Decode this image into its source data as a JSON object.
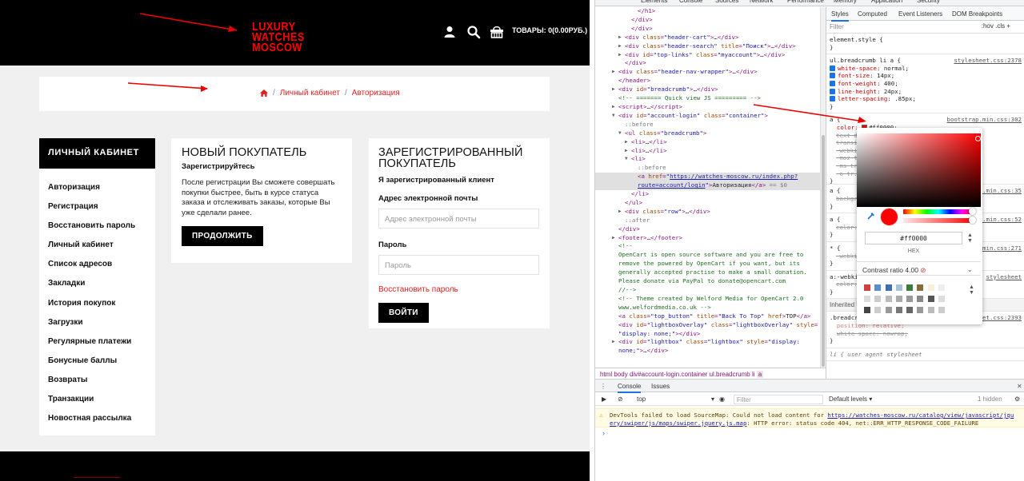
{
  "site": {
    "logo_lines": [
      "LUXURY",
      "WATCHES",
      "MOSCOW"
    ],
    "cart_text": "ТОВАРЫ: 0(0.00РУБ.)",
    "breadcrumb": [
      "Личный кабинет",
      "Авторизация"
    ],
    "breadcrumb_sep": "/",
    "account_menu": {
      "title": "ЛИЧНЫЙ КАБИНЕТ",
      "items": [
        "Авторизация",
        "Регистрация",
        "Восстановить пароль",
        "Личный кабинет",
        "Список адресов",
        "Закладки",
        "История покупок",
        "Загрузки",
        "Регулярные платежи",
        "Бонусные баллы",
        "Возвраты",
        "Транзакции",
        "Новостная рассылка"
      ]
    },
    "new_customer": {
      "title": "НОВЫЙ ПОКУПАТЕЛЬ",
      "subtitle": "Зарегистрируйтесь",
      "text": "После регистрации Вы сможете совершать покупки быстрее, быть в курсе статуса заказа и отслеживать заказы, которые Вы уже сделали ранее.",
      "button": "ПРОДОЛЖИТЬ"
    },
    "registered": {
      "title": "ЗАРЕГИСТРИРОВАННЫЙ ПОКУПАТЕЛЬ",
      "subtitle": "Я зарегистрированный клиент",
      "email_label": "Адрес электронной почты",
      "email_placeholder": "Адрес электронной почты",
      "password_label": "Пароль",
      "password_placeholder": "Пароль",
      "forgot_link": "Восстановить пароль",
      "button": "ВОЙТИ"
    },
    "accent_color": "#ff0000"
  },
  "devtools": {
    "top_tabs": [
      "Elements",
      "Console",
      "Sources",
      "Network",
      "Performance",
      "Memory",
      "Application",
      "Security"
    ],
    "dom_lines": [
      {
        "ind": 3,
        "html": "<span class='tg'>&lt;/h1&gt;</span>"
      },
      {
        "ind": 2,
        "html": "<span class='tg'>&lt;/div&gt;</span>"
      },
      {
        "ind": 2,
        "html": "<span class='tg'>&lt;/div&gt;</span>"
      },
      {
        "ind": 1,
        "tri": "▶",
        "html": "<span class='tg'>&lt;div</span> <span class='an'>class</span>=<span class='av'>\"header-cart\"</span><span class='tg'>&gt;</span><span class='tx'>…</span><span class='tg'>&lt;/div&gt;</span>"
      },
      {
        "ind": 1,
        "tri": "▶",
        "html": "<span class='tg'>&lt;div</span> <span class='an'>class</span>=<span class='av'>\"header-search\"</span> <span class='an'>title</span>=<span class='av'>\"Поиск\"</span><span class='tg'>&gt;</span><span class='tx'>…</span><span class='tg'>&lt;/div&gt;</span>"
      },
      {
        "ind": 1,
        "tri": "▶",
        "html": "<span class='tg'>&lt;div</span> <span class='an'>id</span>=<span class='av'>\"top-links\"</span> <span class='an'>class</span>=<span class='av'>\"myaccount\"</span><span class='tg'>&gt;</span><span class='tx'>…</span><span class='tg'>&lt;/div&gt;</span>"
      },
      {
        "ind": 1,
        "html": "<span class='tg'>&lt;/div&gt;</span>"
      },
      {
        "ind": 0,
        "tri": "▶",
        "html": "<span class='tg'>&lt;div</span> <span class='an'>class</span>=<span class='av'>\"header-nav-wrapper\"</span><span class='tg'>&gt;</span><span class='tx'>…</span><span class='tg'>&lt;/div&gt;</span>"
      },
      {
        "ind": 0,
        "html": "<span class='tg'>&lt;/header&gt;</span>"
      },
      {
        "ind": 0,
        "tri": "▶",
        "html": "<span class='tg'>&lt;div</span> <span class='an'>id</span>=<span class='av'>\"breadcrumb\"</span><span class='tg'>&gt;</span><span class='tx'>…</span><span class='tg'>&lt;/div&gt;</span>"
      },
      {
        "ind": 0,
        "html": "<span class='cm'>&lt;!-- ======= Quick view JS ========= --&gt;</span>"
      },
      {
        "ind": 0,
        "tri": "▶",
        "html": "<span class='tg'>&lt;script&gt;</span><span class='tx'>…</span><span class='tg'>&lt;/script&gt;</span>"
      },
      {
        "ind": 0,
        "tri": "▼",
        "html": "<span class='tg'>&lt;div</span> <span class='an'>id</span>=<span class='av'>\"account-login\"</span> <span class='an'>class</span>=<span class='av'>\"container\"</span><span class='tg'>&gt;</span>"
      },
      {
        "ind": 1,
        "html": "<span class='pe'>::before</span>"
      },
      {
        "ind": 1,
        "tri": "▼",
        "html": "<span class='tg'>&lt;ul</span> <span class='an'>class</span>=<span class='av'>\"breadcrumb\"</span><span class='tg'>&gt;</span>"
      },
      {
        "ind": 2,
        "tri": "▶",
        "html": "<span class='tg'>&lt;li&gt;</span><span class='tx'>…</span><span class='tg'>&lt;/li&gt;</span>"
      },
      {
        "ind": 2,
        "tri": "▶",
        "html": "<span class='tg'>&lt;li&gt;</span><span class='tx'>…</span><span class='tg'>&lt;/li&gt;</span>"
      },
      {
        "ind": 2,
        "tri": "▼",
        "html": "<span class='tg'>&lt;li&gt;</span>"
      },
      {
        "ind": 3,
        "html": "<span class='pe'>::before</span>"
      },
      {
        "ind": 3,
        "sel": true,
        "html": "<span class='tg'>&lt;a</span> <span class='an'>href</span>=<span class='av'>\"<span class='lk'>https://watches-moscow.ru/index.php?</span></span>"
      },
      {
        "ind": 3,
        "sel": true,
        "html": "<span class='av'><span class='lk'>route=account/login</span>\"</span><span class='tg'>&gt;</span><span class='tx'>Авторизация</span><span class='tg'>&lt;/a&gt;</span> <span class='pe'>== $0</span>"
      },
      {
        "ind": 2,
        "html": "<span class='tg'>&lt;/li&gt;</span>"
      },
      {
        "ind": 1,
        "html": "<span class='tg'>&lt;/ul&gt;</span>"
      },
      {
        "ind": 1,
        "tri": "▶",
        "html": "<span class='tg'>&lt;div</span> <span class='an'>class</span>=<span class='av'>\"row\"</span><span class='tg'>&gt;</span><span class='tx'>…</span><span class='tg'>&lt;/div&gt;</span>"
      },
      {
        "ind": 1,
        "html": "<span class='pe'>::after</span>"
      },
      {
        "ind": 0,
        "html": "<span class='tg'>&lt;/div&gt;</span>"
      },
      {
        "ind": 0,
        "tri": "▶",
        "html": "<span class='tg'>&lt;footer&gt;</span><span class='tx'>…</span><span class='tg'>&lt;/footer&gt;</span>"
      },
      {
        "ind": 0,
        "html": "<span class='cm'>&lt;!--</span>"
      },
      {
        "ind": 0,
        "html": "<span class='cm'>OpenCart is open source software and you are free to</span>"
      },
      {
        "ind": 0,
        "html": "<span class='cm'>remove the powered by OpenCart if you want, but its</span>"
      },
      {
        "ind": 0,
        "html": "<span class='cm'>generally accepted practise to make a small donation.</span>"
      },
      {
        "ind": 0,
        "html": "<span class='cm'>Please donate via PayPal to donate@opencart.com</span>"
      },
      {
        "ind": 0,
        "html": "<span class='cm'>//--&gt;</span>"
      },
      {
        "ind": 0,
        "html": "<span class='cm'>&lt;!-- Theme created by Welford Media for OpenCart 2.0</span>"
      },
      {
        "ind": 0,
        "html": "<span class='cm'>www.welfordmedia.co.uk --&gt;</span>"
      },
      {
        "ind": 0,
        "html": "<span class='tg'>&lt;a</span> <span class='an'>class</span>=<span class='av'>\"top_button\"</span> <span class='an'>title</span>=<span class='av'>\"Back To Top\"</span> <span class='an'>href</span><span class='tg'>&gt;</span><span class='tx'>TOP</span><span class='tg'>&lt;/a&gt;</span>"
      },
      {
        "ind": 0,
        "html": "<span class='tg'>&lt;div</span> <span class='an'>id</span>=<span class='av'>\"lightboxOverlay\"</span> <span class='an'>class</span>=<span class='av'>\"lightboxOverlay\"</span> <span class='an'>style</span>="
      },
      {
        "ind": 0,
        "html": "<span class='av'>\"display: none;\"</span><span class='tg'>&gt;&lt;/div&gt;</span>"
      },
      {
        "ind": 0,
        "tri": "▶",
        "html": "<span class='tg'>&lt;div</span> <span class='an'>id</span>=<span class='av'>\"lightbox\"</span> <span class='an'>class</span>=<span class='av'>\"lightbox\"</span> <span class='an'>style</span>=<span class='av'>\"display:</span>"
      },
      {
        "ind": 0,
        "html": "<span class='av'>none;\"</span><span class='tg'>&gt;</span><span class='tx'>…</span><span class='tg'>&lt;/div&gt;</span>"
      }
    ],
    "dom_crumbs": [
      "html",
      "body",
      "div#account-login.container",
      "ul.breadcrumb",
      "li",
      "a"
    ],
    "styles_tabs": [
      "Styles",
      "Computed",
      "Event Listeners",
      "DOM Breakpoints"
    ],
    "filter_placeholder": "Filter",
    "hov_cls": ":hov  .cls  +",
    "element_style": "element.style {",
    "rule1": {
      "selector": "ul.breadcrumb li a {",
      "source": "stylesheet.css:2378",
      "props": [
        "white-space: normal;",
        "font-size: 14px;",
        "font-weight: 400;",
        "line-height: 24px;",
        "letter-spacing: .85px;"
      ]
    },
    "rule2_source": "bootstrap.min.css:302",
    "rule2_color_prop": "color:",
    "rule2_color_val": "#ff0000;",
    "rule2_struck": [
      "text-d...",
      "transi...",
      "-webki...",
      "-moz-t...",
      "-ms-tr...",
      "-o-tr..."
    ],
    "partial_rules": [
      {
        "sel": "a {",
        "src": "...min.css:35",
        "line": "backgr..."
      },
      {
        "sel": "a {",
        "src": "...min.css:52",
        "line": "color:"
      },
      {
        "sel": "* {",
        "src": "...min.css:271",
        "line": "-webki...  -moz-b...  box-si..."
      },
      {
        "sel": "a:-webkit-any-link {",
        "src": "stylesheet",
        "line": "color:  cursor:  text-d..."
      }
    ],
    "inherited_from": "Inherited from",
    "inherited_el": "li",
    "rule3": {
      "selector": ".breadcrumb > li {",
      "source": "stylesheet.css:2393",
      "props": [
        "position: relative;",
        "white-space: nowrap;"
      ]
    },
    "rule4_hint": "li {   user agent stylesheet",
    "picker": {
      "hex": "#ff0000",
      "hex_label": "HEX",
      "contrast_label": "Contrast ratio 4.00",
      "palette": [
        [
          "#d04040",
          "#5b8fc9",
          "#3f6fae",
          "#a7c1d9",
          "#3d7a3d",
          "#8a6a3a",
          "#f6f0d8",
          "#eeeeee"
        ],
        [
          "#dddddd",
          "#cccccc",
          "#bbbbbb",
          "#aaaaaa",
          "#999999",
          "#888888",
          "#555555",
          "#dddddd"
        ],
        [
          "#444444",
          "#cccccc",
          "#999999",
          "#777777",
          "#666666",
          "#999999",
          "#bbbbbb",
          "#cccccc"
        ]
      ]
    },
    "console": {
      "tabs": [
        "Console",
        "Issues"
      ],
      "context": "top",
      "filter_placeholder": "Filter",
      "levels": "Default levels ▾",
      "hidden": "1 hidden",
      "warning_prefix": "DevTools failed to load SourceMap: Could not load content for ",
      "warning_link1": "https://watches-moscow.ru/catalog/view/javascript/jqu",
      "warning_link2": "ery/swiper/js/maps/swiper.jquery.js.map",
      "warning_suffix": ": HTTP error: status code 404, net::ERR_HTTP_RESPONSE_CODE_FAILURE",
      "prompt": "›"
    }
  }
}
